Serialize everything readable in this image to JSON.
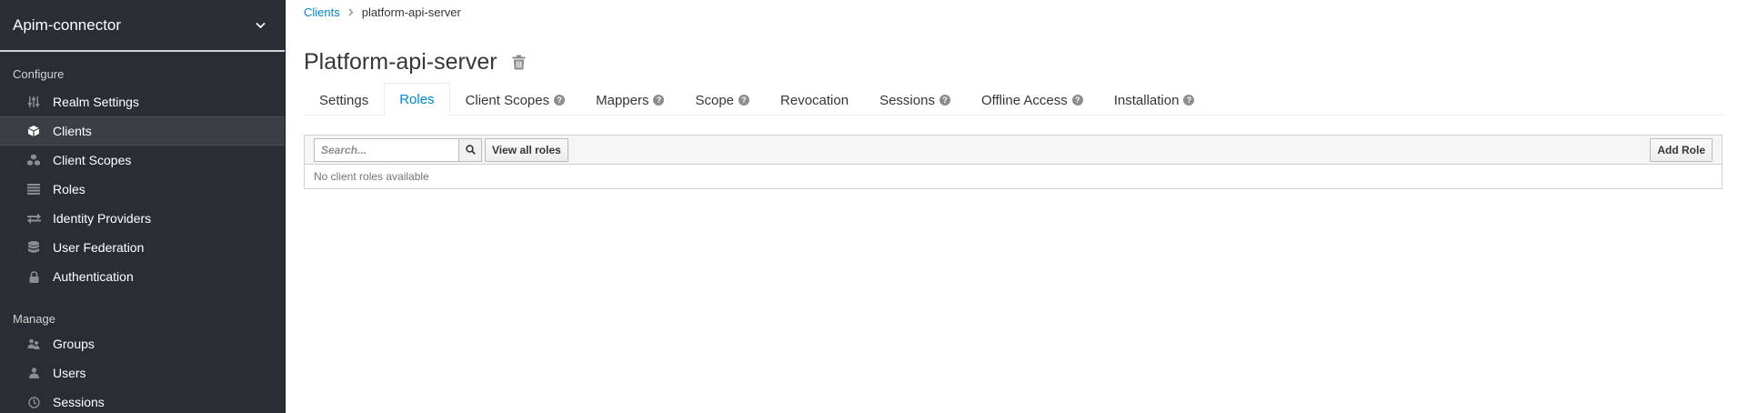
{
  "sidebar": {
    "realm_name": "Apim-connector",
    "configure_title": "Configure",
    "manage_title": "Manage",
    "configure_items": [
      {
        "label": "Realm Settings",
        "icon": "sliders-icon"
      },
      {
        "label": "Clients",
        "icon": "cube-icon",
        "active": true
      },
      {
        "label": "Client Scopes",
        "icon": "cubes-icon"
      },
      {
        "label": "Roles",
        "icon": "list-icon"
      },
      {
        "label": "Identity Providers",
        "icon": "exchange-icon"
      },
      {
        "label": "User Federation",
        "icon": "database-icon"
      },
      {
        "label": "Authentication",
        "icon": "lock-icon"
      }
    ],
    "manage_items": [
      {
        "label": "Groups",
        "icon": "users-icon"
      },
      {
        "label": "Users",
        "icon": "user-icon"
      },
      {
        "label": "Sessions",
        "icon": "clock-icon"
      }
    ]
  },
  "breadcrumb": {
    "parent": "Clients",
    "current": "platform-api-server"
  },
  "page": {
    "title": "Platform-api-server"
  },
  "tabs": [
    {
      "label": "Settings",
      "help": false
    },
    {
      "label": "Roles",
      "help": false,
      "active": true
    },
    {
      "label": "Client Scopes",
      "help": true
    },
    {
      "label": "Mappers",
      "help": true
    },
    {
      "label": "Scope",
      "help": true
    },
    {
      "label": "Revocation",
      "help": false
    },
    {
      "label": "Sessions",
      "help": true
    },
    {
      "label": "Offline Access",
      "help": true
    },
    {
      "label": "Installation",
      "help": true
    }
  ],
  "roles_table": {
    "search_placeholder": "Search...",
    "view_all_label": "View all roles",
    "add_role_label": "Add Role",
    "empty_message": "No client roles available"
  },
  "colors": {
    "sidebar_bg": "#292e34",
    "accent": "#0088ce",
    "active_nav_bg": "#393f44"
  }
}
